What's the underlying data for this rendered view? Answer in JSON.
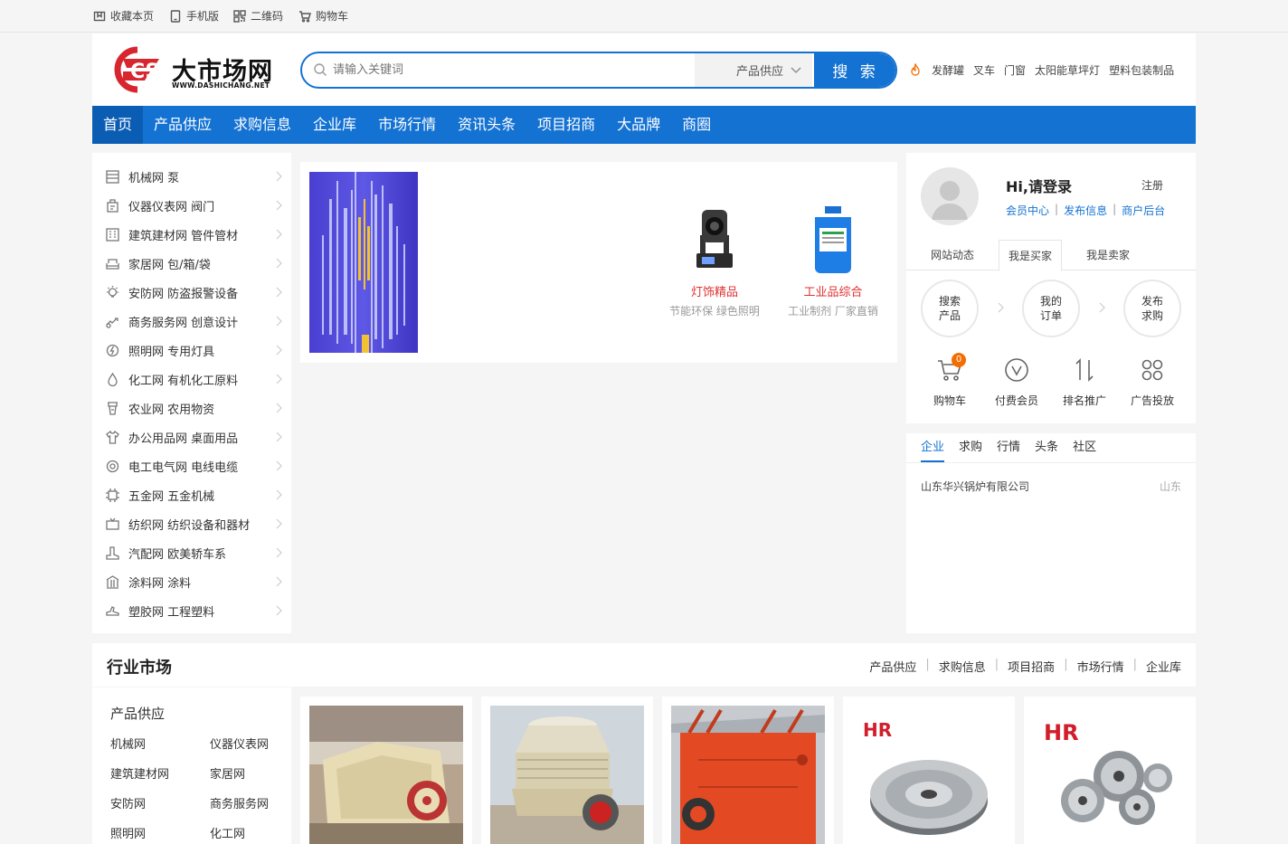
{
  "topbar": {
    "items": [
      {
        "label": "收藏本页",
        "icon": "bookmark-icon"
      },
      {
        "label": "手机版",
        "icon": "mobile-icon"
      },
      {
        "label": "二维码",
        "icon": "qrcode-icon"
      },
      {
        "label": "购物车",
        "icon": "cart-icon"
      }
    ]
  },
  "header": {
    "logo_text": "大市场网",
    "logo_sub": "WWW.DASHICHANG.NET",
    "logo_mark": "CS",
    "search_placeholder": "请输入关键词",
    "search_select": "产品供应",
    "search_button": "搜 索",
    "hot_keywords": [
      "发酵罐",
      "叉车",
      "门窗",
      "太阳能草坪灯",
      "塑料包装制品"
    ]
  },
  "nav": {
    "items": [
      "首页",
      "产品供应",
      "求购信息",
      "企业库",
      "市场行情",
      "资讯头条",
      "项目招商",
      "大品牌",
      "商圈"
    ],
    "active_index": 0
  },
  "categories": [
    {
      "label": "机械网 泵",
      "icon": "machine-icon"
    },
    {
      "label": "仪器仪表网 阀门",
      "icon": "instrument-icon"
    },
    {
      "label": "建筑建材网 管件管材",
      "icon": "building-icon"
    },
    {
      "label": "家居网 包/箱/袋",
      "icon": "sofa-icon"
    },
    {
      "label": "安防网 防盗报警设备",
      "icon": "bulb-alarm-icon"
    },
    {
      "label": "商务服务网 创意设计",
      "icon": "handshake-icon"
    },
    {
      "label": "照明网 专用灯具",
      "icon": "power-icon"
    },
    {
      "label": "化工网 有机化工原料",
      "icon": "drop-icon"
    },
    {
      "label": "农业网 农用物资",
      "icon": "farm-icon"
    },
    {
      "label": "办公用品网 桌面用品",
      "icon": "shirt-icon"
    },
    {
      "label": "电工电气网 电线电缆",
      "icon": "gear-icon"
    },
    {
      "label": "五金网 五金机械",
      "icon": "chip-icon"
    },
    {
      "label": "纺织网 纺织设备和器材",
      "icon": "tv-icon"
    },
    {
      "label": "汽配网 欧美轿车系",
      "icon": "boot-icon"
    },
    {
      "label": "涂料网 涂料",
      "icon": "paint-icon"
    },
    {
      "label": "塑胶网 工程塑料",
      "icon": "shoe-icon"
    }
  ],
  "banner": {
    "products": [
      {
        "title": "灯饰精品",
        "sub": "节能环保 绿色照明",
        "icon": "stage-light-icon"
      },
      {
        "title": "工业品综合",
        "sub": "工业制剂 厂家直销",
        "icon": "chemical-bucket-icon"
      }
    ]
  },
  "user_panel": {
    "greeting": "Hi,请登录",
    "register": "注册",
    "links": [
      "会员中心",
      "发布信息",
      "商户后台"
    ],
    "tabs": [
      "网站动态",
      "我是买家",
      "我是卖家"
    ],
    "active_tab": 1,
    "circles": [
      [
        "搜索",
        "产品"
      ],
      [
        "我的",
        "订单"
      ],
      [
        "发布",
        "求购"
      ]
    ],
    "quick": [
      {
        "label": "购物车",
        "icon": "cart-icon",
        "badge": "0"
      },
      {
        "label": "付费会员",
        "icon": "vip-icon"
      },
      {
        "label": "排名推广",
        "icon": "sort-icon"
      },
      {
        "label": "广告投放",
        "icon": "grid-icon"
      }
    ]
  },
  "news_panel": {
    "tabs": [
      "企业",
      "求购",
      "行情",
      "头条",
      "社区"
    ],
    "active_tab": 0,
    "rows": [
      {
        "name": "山东华兴锅炉有限公司",
        "region": "山东"
      }
    ]
  },
  "industry": {
    "title": "行业市场",
    "links": [
      "产品供应",
      "求购信息",
      "项目招商",
      "市场行情",
      "企业库"
    ],
    "sub_title": "产品供应",
    "markets": [
      "机械网",
      "仪器仪表网",
      "建筑建材网",
      "家居网",
      "安防网",
      "商务服务网",
      "照明网",
      "化工网"
    ],
    "cards": [
      {
        "image": "crusher-image"
      },
      {
        "image": "cone-crusher-image"
      },
      {
        "image": "impact-crusher-image"
      },
      {
        "image": "pulley-image",
        "logo": "HR"
      },
      {
        "image": "pulleys-image",
        "logo": "HR"
      }
    ]
  },
  "colors": {
    "brand_blue": "#1472d3",
    "accent_red": "#e0312f",
    "logo_red": "#d8262f",
    "badge_orange": "#f56c00"
  }
}
